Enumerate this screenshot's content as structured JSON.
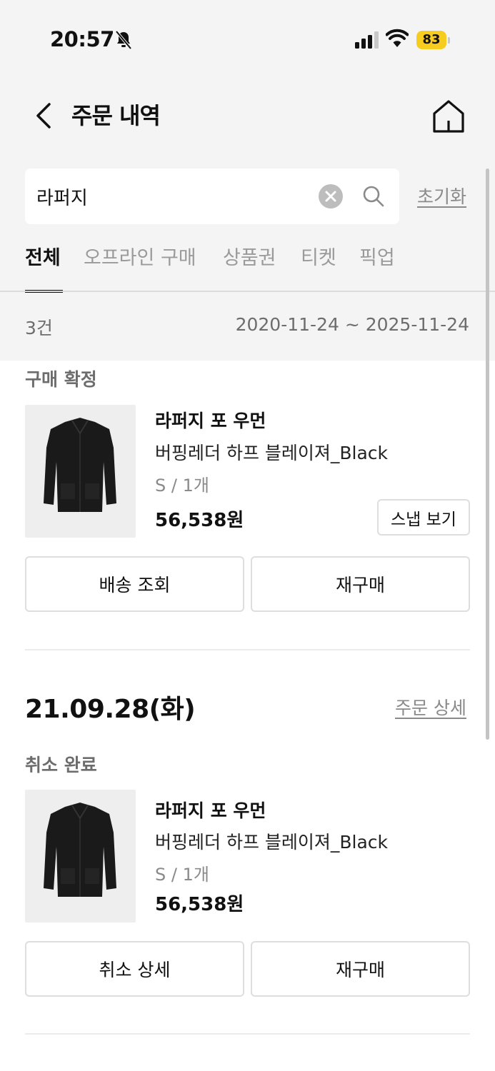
{
  "status_bar": {
    "time": "20:57",
    "battery": "83"
  },
  "header": {
    "title": "주문 내역"
  },
  "search": {
    "value": "라퍼지",
    "reset_label": "초기화"
  },
  "tabs": [
    {
      "label": "전체",
      "active": true
    },
    {
      "label": "오프라인 구매",
      "active": false
    },
    {
      "label": "상품권",
      "active": false
    },
    {
      "label": "티켓",
      "active": false
    },
    {
      "label": "픽업",
      "active": false
    }
  ],
  "summary": {
    "count": "3건",
    "date_range": "2020-11-24 ~ 2025-11-24"
  },
  "orders": [
    {
      "status": "구매 확정",
      "brand": "라퍼지 포 우먼",
      "name": "버핑레더 하프 블레이져_Black",
      "option": "S / 1개",
      "price": "56,538원",
      "snap_label": "스냅 보기",
      "actions": [
        "배송 조회",
        "재구매"
      ]
    },
    {
      "date": "21.09.28(화)",
      "detail_label": "주문 상세",
      "status": "취소 완료",
      "brand": "라퍼지 포 우먼",
      "name": "버핑레더 하프 블레이져_Black",
      "option": "S / 1개",
      "price": "56,538원",
      "actions": [
        "취소 상세",
        "재구매"
      ]
    }
  ],
  "colors": {
    "accent_battery": "#f6cd1e",
    "muted_text": "#8a8a8a",
    "top_bg": "#f4f4f4"
  }
}
